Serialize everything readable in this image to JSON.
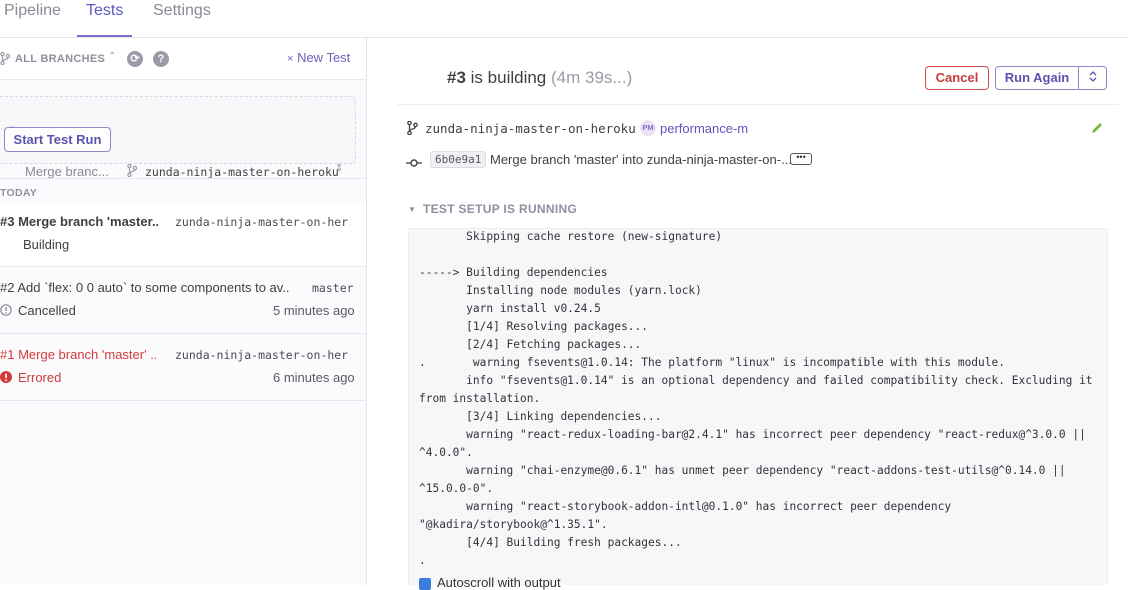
{
  "tabs": [
    {
      "label": "Pipeline"
    },
    {
      "label": "Tests"
    },
    {
      "label": "Settings"
    }
  ],
  "sidebar": {
    "branch_filter": "ALL BRANCHES",
    "new_test": "New Test",
    "run_form": {
      "commit_select": "Merge branc...",
      "branch_select": "zunda-ninja-master-on-heroku",
      "start_button": "Start Test Run"
    },
    "section_label": "TODAY",
    "runs": [
      {
        "title": "#3 Merge branch 'master...",
        "branch": "zunda-ninja-master-on-her...",
        "status": "Building",
        "time": "",
        "status_color": "#3f3f44"
      },
      {
        "title": "#2 Add `flex: 0 0 auto` to some components to av...",
        "branch": "master",
        "status": "Cancelled",
        "time": "5 minutes ago",
        "status_color": "#3f3f44"
      },
      {
        "title": "#1 Merge branch 'master' ...",
        "branch": "zunda-ninja-master-on-her...",
        "status": "Errored",
        "time": "6 minutes ago",
        "status_color": "#d23b3b"
      }
    ]
  },
  "build": {
    "number": "#3",
    "state": "is building",
    "elapsed": "(4m 39s...)",
    "cancel_label": "Cancel",
    "run_again_label": "Run Again",
    "branch": "zunda-ninja-master-on-heroku",
    "pipeline_badge": "PM",
    "pipeline": "performance-m",
    "sha": "6b0e9a1",
    "commit_message": "Merge branch 'master' into zunda-ninja-master-on-...",
    "setup_label": "TEST SETUP IS RUNNING",
    "log_lines": [
      "       Skipping cache restore (new-signature)",
      "",
      "-----> Building dependencies",
      "       Installing node modules (yarn.lock)",
      "       yarn install v0.24.5",
      "       [1/4] Resolving packages...",
      "       [2/4] Fetching packages...",
      ".       warning fsevents@1.0.14: The platform \"linux\" is incompatible with this module.",
      "       info \"fsevents@1.0.14\" is an optional dependency and failed compatibility check. Excluding it",
      "from installation.",
      "       [3/4] Linking dependencies...",
      "       warning \"react-redux-loading-bar@2.4.1\" has incorrect peer dependency \"react-redux@^3.0.0 ||",
      "^4.0.0\".",
      "       warning \"chai-enzyme@0.6.1\" has unmet peer dependency \"react-addons-test-utils@^0.14.0 ||",
      "^15.0.0-0\".",
      "       warning \"react-storybook-addon-intl@0.1.0\" has incorrect peer dependency",
      "\"@kadira/storybook@^1.35.1\".",
      "       [4/4] Building fresh packages...",
      "."
    ],
    "autoscroll_label": "Autoscroll with output"
  },
  "colors": {
    "accent": "#5a5ac0",
    "danger": "#d23b3b",
    "success": "#79b83c"
  }
}
